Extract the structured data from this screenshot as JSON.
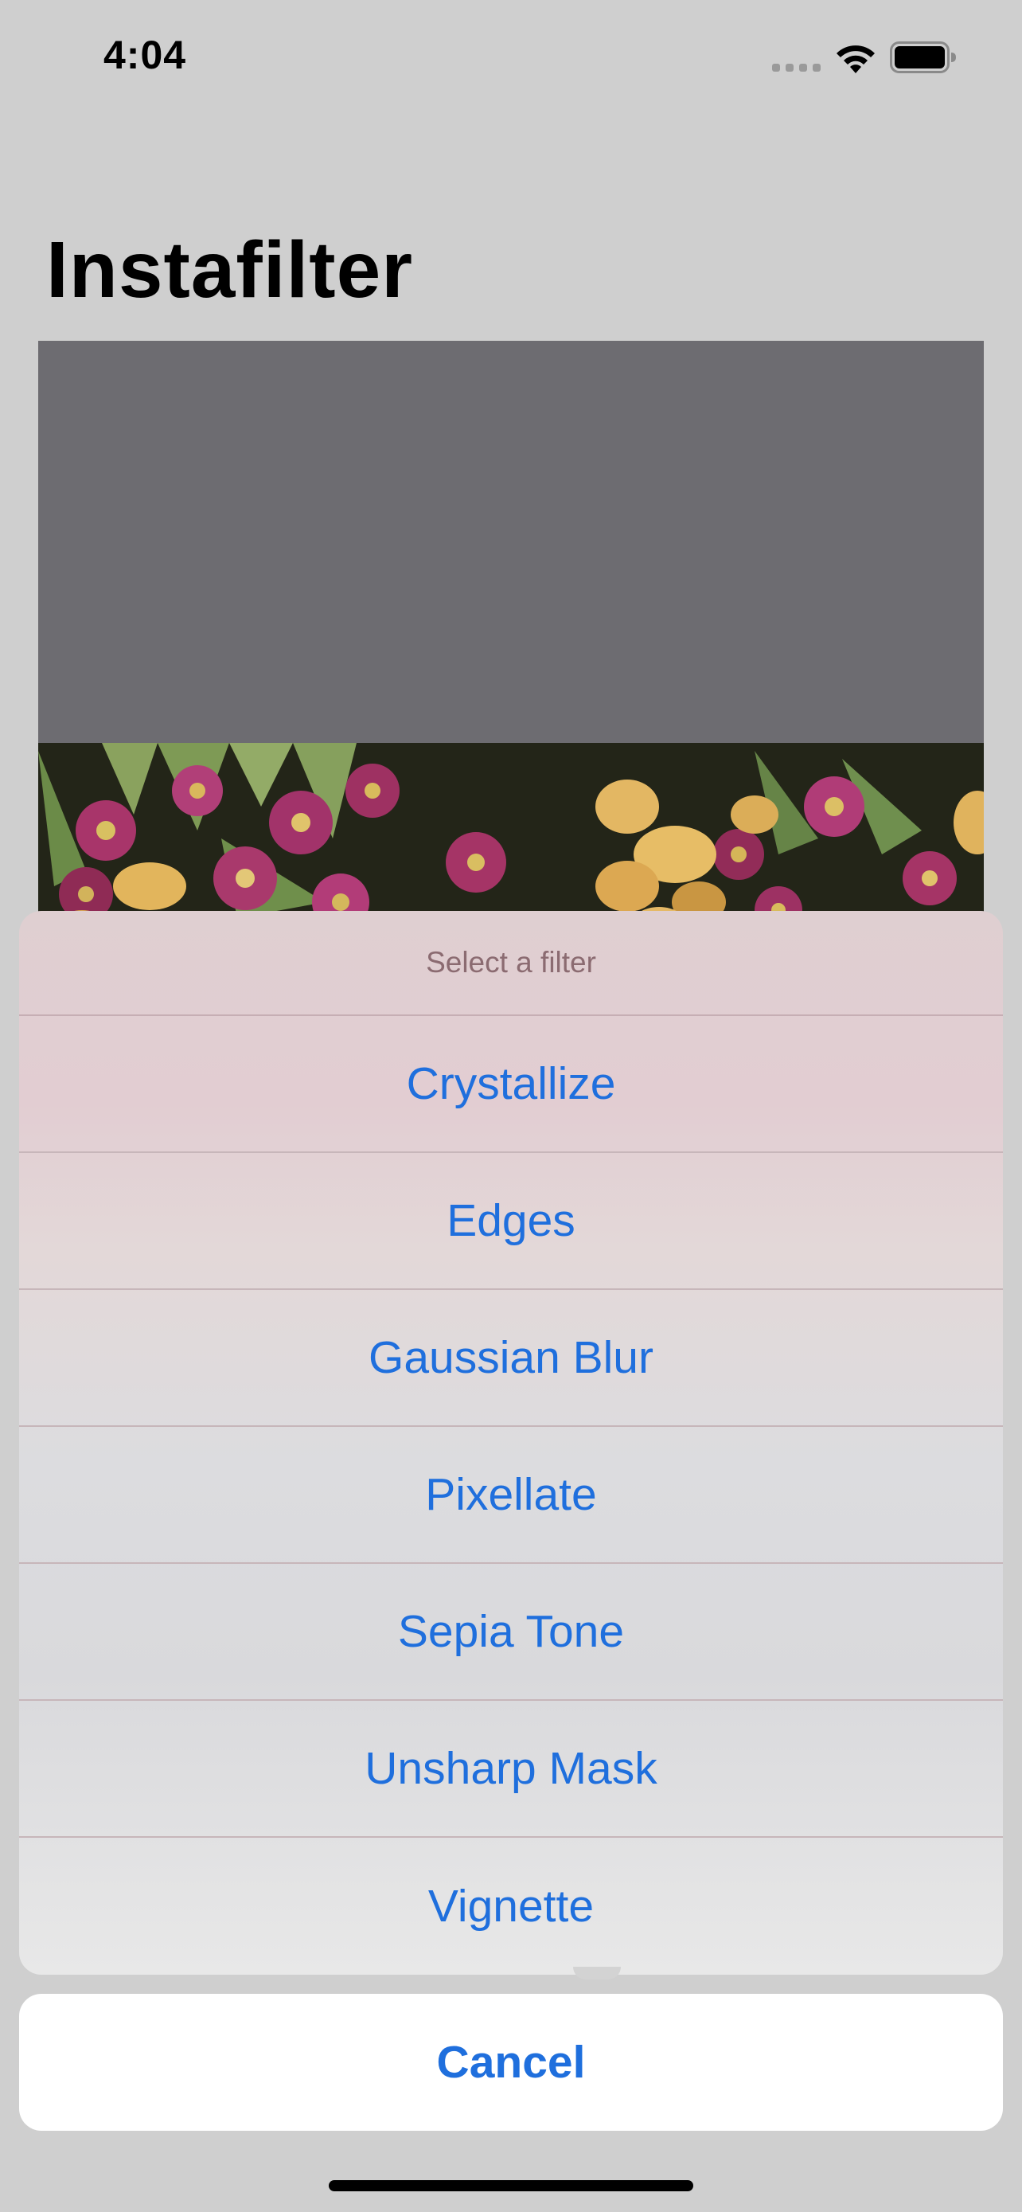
{
  "status_bar": {
    "time": "4:04",
    "icons": [
      "signal-icon",
      "wifi-icon",
      "battery-icon"
    ]
  },
  "page": {
    "title": "Instafilter"
  },
  "action_sheet": {
    "title": "Select a filter",
    "options": [
      {
        "label": "Crystallize"
      },
      {
        "label": "Edges"
      },
      {
        "label": "Gaussian Blur"
      },
      {
        "label": "Pixellate"
      },
      {
        "label": "Sepia Tone"
      },
      {
        "label": "Unsharp Mask"
      },
      {
        "label": "Vignette"
      }
    ],
    "cancel_label": "Cancel"
  },
  "colors": {
    "accent": "#1f6fdd",
    "background": "#cfcfcf",
    "image_placeholder": "#6d6c71"
  }
}
